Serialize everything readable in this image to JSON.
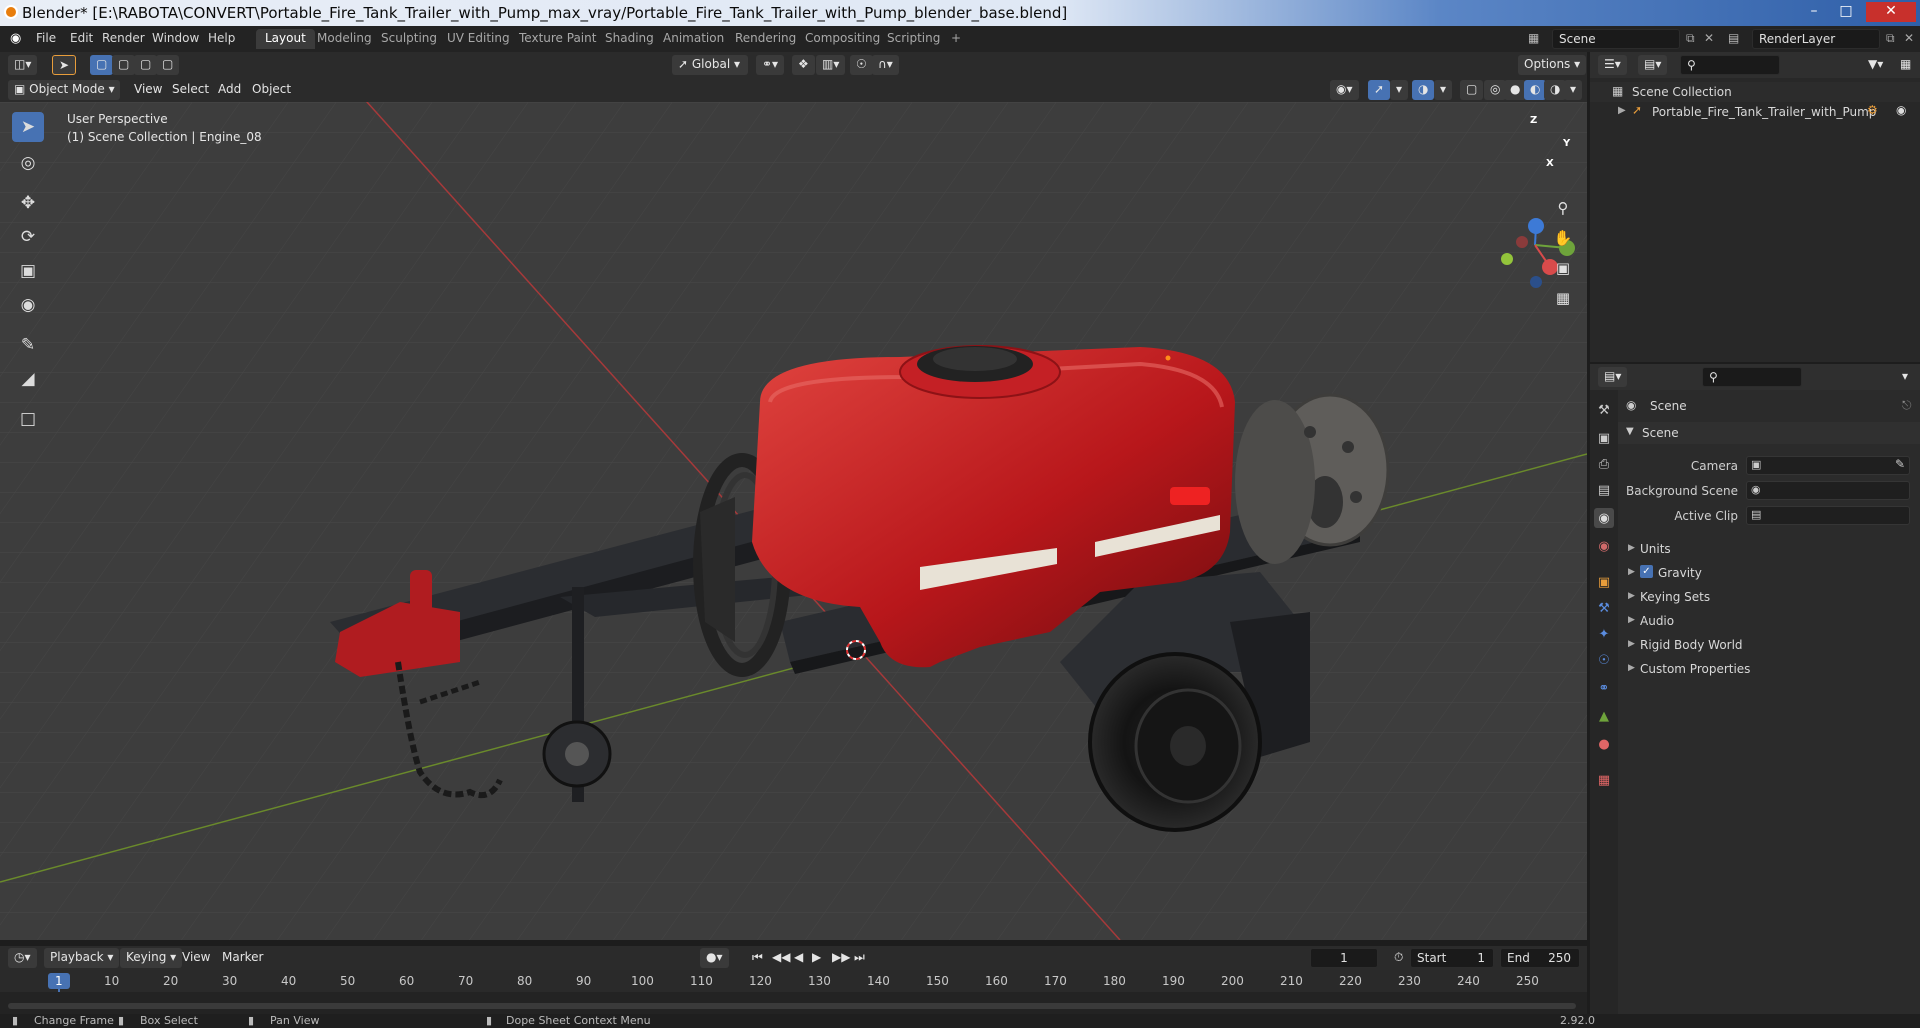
{
  "window": {
    "title": "Blender* [E:\\RABOTA\\CONVERT\\Portable_Fire_Tank_Trailer_with_Pump_max_vray/Portable_Fire_Tank_Trailer_with_Pump_blender_base.blend]",
    "controls": [
      "minimize",
      "maximize",
      "close"
    ]
  },
  "menu": [
    "File",
    "Edit",
    "Render",
    "Window",
    "Help"
  ],
  "workspaces": {
    "tabs": [
      "Layout",
      "Modeling",
      "Sculpting",
      "UV Editing",
      "Texture Paint",
      "Shading",
      "Animation",
      "Rendering",
      "Compositing",
      "Scripting"
    ],
    "active": "Layout",
    "add": "+"
  },
  "scene_field": "Scene",
  "view_layer_field": "RenderLayer",
  "viewport_header": {
    "orientation": "Global",
    "options": "Options",
    "mode": "Object Mode",
    "menus": [
      "View",
      "Select",
      "Add",
      "Object"
    ]
  },
  "viewport": {
    "perspective": "User Perspective",
    "collection_info": "(1) Scene Collection | Engine_08",
    "gizmo": {
      "x": "X",
      "y": "Y",
      "z": "Z"
    }
  },
  "outliner": {
    "root": "Scene Collection",
    "items": [
      {
        "name": "Portable_Fire_Tank_Trailer_with_Pump"
      }
    ]
  },
  "properties": {
    "context": "Scene",
    "panel": "Scene",
    "fields": [
      {
        "label": "Camera"
      },
      {
        "label": "Background Scene"
      },
      {
        "label": "Active Clip"
      }
    ],
    "sections": [
      {
        "label": "Units"
      },
      {
        "label": "Gravity",
        "checked": true
      },
      {
        "label": "Keying Sets"
      },
      {
        "label": "Audio"
      },
      {
        "label": "Rigid Body World"
      },
      {
        "label": "Custom Properties"
      }
    ]
  },
  "timeline": {
    "menus": [
      "Playback",
      "Keying",
      "View",
      "Marker"
    ],
    "current_frame": "1",
    "start_label": "Start",
    "start": "1",
    "end_label": "End",
    "end": "250",
    "ticks": [
      "1",
      "10",
      "20",
      "30",
      "40",
      "50",
      "60",
      "70",
      "80",
      "90",
      "100",
      "110",
      "120",
      "130",
      "140",
      "150",
      "160",
      "170",
      "180",
      "190",
      "200",
      "210",
      "220",
      "230",
      "240",
      "250"
    ]
  },
  "status": {
    "items": [
      "Change Frame",
      "Box Select",
      "Pan View",
      "Dope Sheet Context Menu"
    ],
    "version": "2.92.0"
  }
}
